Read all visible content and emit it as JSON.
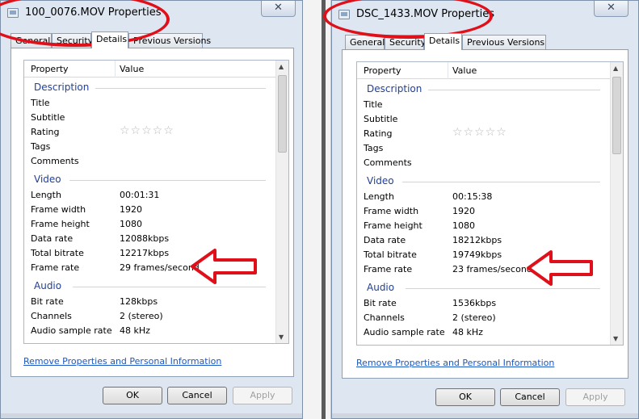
{
  "dialogs": [
    {
      "title": "100_0076.MOV Properties",
      "close_glyph": "✕",
      "tabs": [
        "General",
        "Security",
        "Details",
        "Previous Versions"
      ],
      "active_tab": "Details",
      "columns": {
        "property": "Property",
        "value": "Value"
      },
      "sections": {
        "description": "Description",
        "video": "Video",
        "audio": "Audio"
      },
      "description_rows": [
        {
          "label": "Title",
          "value": ""
        },
        {
          "label": "Subtitle",
          "value": ""
        },
        {
          "label": "Rating",
          "value": "☆☆☆☆☆"
        },
        {
          "label": "Tags",
          "value": ""
        },
        {
          "label": "Comments",
          "value": ""
        }
      ],
      "video_rows": [
        {
          "label": "Length",
          "value": "00:01:31"
        },
        {
          "label": "Frame width",
          "value": "1920"
        },
        {
          "label": "Frame height",
          "value": "1080"
        },
        {
          "label": "Data rate",
          "value": "12088kbps"
        },
        {
          "label": "Total bitrate",
          "value": "12217kbps"
        },
        {
          "label": "Frame rate",
          "value": "29 frames/second"
        }
      ],
      "audio_rows": [
        {
          "label": "Bit rate",
          "value": "128kbps"
        },
        {
          "label": "Channels",
          "value": "2 (stereo)"
        },
        {
          "label": "Audio sample rate",
          "value": "48 kHz"
        }
      ],
      "remove_link": "Remove Properties and Personal Information",
      "buttons": {
        "ok": "OK",
        "cancel": "Cancel",
        "apply": "Apply"
      }
    },
    {
      "title": "DSC_1433.MOV Properties",
      "close_glyph": "✕",
      "tabs": [
        "General",
        "Security",
        "Details",
        "Previous Versions"
      ],
      "active_tab": "Details",
      "columns": {
        "property": "Property",
        "value": "Value"
      },
      "sections": {
        "description": "Description",
        "video": "Video",
        "audio": "Audio"
      },
      "description_rows": [
        {
          "label": "Title",
          "value": ""
        },
        {
          "label": "Subtitle",
          "value": ""
        },
        {
          "label": "Rating",
          "value": "☆☆☆☆☆"
        },
        {
          "label": "Tags",
          "value": ""
        },
        {
          "label": "Comments",
          "value": ""
        }
      ],
      "video_rows": [
        {
          "label": "Length",
          "value": "00:15:38"
        },
        {
          "label": "Frame width",
          "value": "1920"
        },
        {
          "label": "Frame height",
          "value": "1080"
        },
        {
          "label": "Data rate",
          "value": "18212kbps"
        },
        {
          "label": "Total bitrate",
          "value": "19749kbps"
        },
        {
          "label": "Frame rate",
          "value": "23 frames/second"
        }
      ],
      "audio_rows": [
        {
          "label": "Bit rate",
          "value": "1536kbps"
        },
        {
          "label": "Channels",
          "value": "2 (stereo)"
        },
        {
          "label": "Audio sample rate",
          "value": "48 kHz"
        }
      ],
      "remove_link": "Remove Properties and Personal Information",
      "buttons": {
        "ok": "OK",
        "cancel": "Cancel",
        "apply": "Apply"
      }
    }
  ],
  "annotation_color": "#e0101a",
  "accent_colors": {
    "section_heading": "#1e3f9a",
    "link": "#1a57c4",
    "dialog_background": "#dde6f1"
  }
}
